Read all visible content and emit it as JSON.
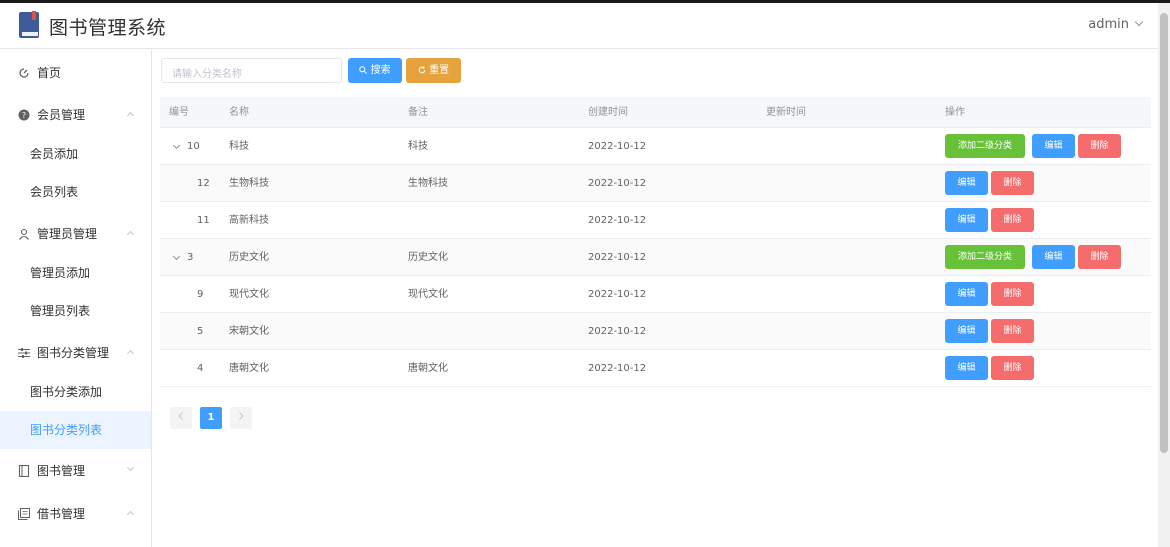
{
  "app": {
    "title": "图书管理系统",
    "user": "admin"
  },
  "sidebar": {
    "items": [
      {
        "label": "首页",
        "icon": "dashboard-icon"
      },
      {
        "label": "会员管理",
        "icon": "question-circle-icon",
        "children": [
          "会员添加",
          "会员列表"
        ]
      },
      {
        "label": "管理员管理",
        "icon": "user-icon",
        "children": [
          "管理员添加",
          "管理员列表"
        ]
      },
      {
        "label": "图书分类管理",
        "icon": "sliders-icon",
        "children": [
          "图书分类添加",
          "图书分类列表"
        ]
      },
      {
        "label": "图书管理",
        "icon": "book-icon"
      },
      {
        "label": "借书管理",
        "icon": "copy-icon"
      }
    ],
    "active": "图书分类列表"
  },
  "search": {
    "placeholder": "请输入分类名称",
    "search_label": "搜索",
    "reset_label": "重置"
  },
  "table": {
    "columns": [
      "编号",
      "名称",
      "备注",
      "创建时间",
      "更新时间",
      "操作"
    ],
    "rows": [
      {
        "id": "10",
        "name": "科技",
        "note": "科技",
        "created": "2022-10-12",
        "updated": "",
        "parent": true
      },
      {
        "id": "12",
        "name": "生物科技",
        "note": "生物科技",
        "created": "2022-10-12",
        "updated": "",
        "parent": false
      },
      {
        "id": "11",
        "name": "高新科技",
        "note": "",
        "created": "2022-10-12",
        "updated": "",
        "parent": false
      },
      {
        "id": "3",
        "name": "历史文化",
        "note": "历史文化",
        "created": "2022-10-12",
        "updated": "",
        "parent": true
      },
      {
        "id": "9",
        "name": "现代文化",
        "note": "现代文化",
        "created": "2022-10-12",
        "updated": "",
        "parent": false
      },
      {
        "id": "5",
        "name": "宋朝文化",
        "note": "",
        "created": "2022-10-12",
        "updated": "",
        "parent": false
      },
      {
        "id": "4",
        "name": "唐朝文化",
        "note": "唐朝文化",
        "created": "2022-10-12",
        "updated": "",
        "parent": false
      }
    ],
    "actions": {
      "add": "添加二级分类",
      "edit": "编辑",
      "delete": "删除"
    }
  },
  "pagination": {
    "current": "1"
  },
  "colors": {
    "primary": "#409eff",
    "success": "#67c23a",
    "warning": "#e6a23c",
    "danger": "#f56c6c"
  }
}
